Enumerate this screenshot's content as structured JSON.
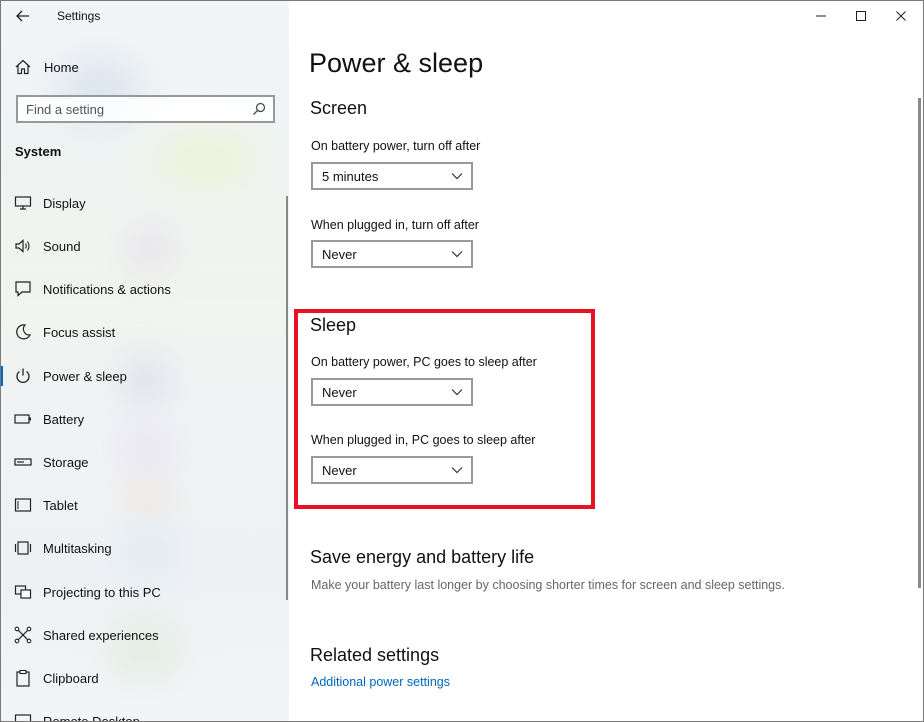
{
  "window": {
    "title": "Settings",
    "minimize_icon": "minimize-icon",
    "maximize_icon": "maximize-icon",
    "close_icon": "close-icon"
  },
  "sidebar": {
    "home_label": "Home",
    "search_placeholder": "Find a setting",
    "section_title": "System",
    "items": [
      {
        "label": "Display",
        "icon": "display-icon"
      },
      {
        "label": "Sound",
        "icon": "sound-icon"
      },
      {
        "label": "Notifications & actions",
        "icon": "notifications-icon"
      },
      {
        "label": "Focus assist",
        "icon": "focus-assist-icon"
      },
      {
        "label": "Power & sleep",
        "icon": "power-icon",
        "active": true
      },
      {
        "label": "Battery",
        "icon": "battery-icon"
      },
      {
        "label": "Storage",
        "icon": "storage-icon"
      },
      {
        "label": "Tablet",
        "icon": "tablet-icon"
      },
      {
        "label": "Multitasking",
        "icon": "multitasking-icon"
      },
      {
        "label": "Projecting to this PC",
        "icon": "projecting-icon"
      },
      {
        "label": "Shared experiences",
        "icon": "shared-experiences-icon"
      },
      {
        "label": "Clipboard",
        "icon": "clipboard-icon"
      },
      {
        "label": "Remote Desktop",
        "icon": "remote-desktop-icon"
      }
    ]
  },
  "main": {
    "page_title": "Power & sleep",
    "screen": {
      "heading": "Screen",
      "battery_label": "On battery power, turn off after",
      "battery_value": "5 minutes",
      "plugged_label": "When plugged in, turn off after",
      "plugged_value": "Never"
    },
    "sleep": {
      "heading": "Sleep",
      "battery_label": "On battery power, PC goes to sleep after",
      "battery_value": "Never",
      "plugged_label": "When plugged in, PC goes to sleep after",
      "plugged_value": "Never"
    },
    "save_energy": {
      "heading": "Save energy and battery life",
      "description": "Make your battery last longer by choosing shorter times for screen and sleep settings."
    },
    "related": {
      "heading": "Related settings",
      "link": "Additional power settings"
    }
  },
  "colors": {
    "accent": "#0067c0",
    "highlight": "#e81123"
  }
}
